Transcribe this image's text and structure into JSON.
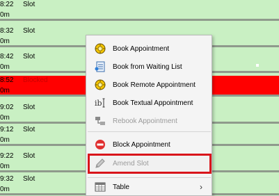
{
  "schedule": {
    "rows": [
      {
        "time": "8:22",
        "duration": "0m",
        "status": "Slot",
        "blocked": false
      },
      {
        "time": "8:32",
        "duration": "0m",
        "status": "Slot",
        "blocked": false
      },
      {
        "time": "8:42",
        "duration": "0m",
        "status": "Slot",
        "blocked": false
      },
      {
        "time": "8:52",
        "duration": "0m",
        "status": "Blocked",
        "blocked": true
      },
      {
        "time": "9:02",
        "duration": "0m",
        "status": "Slot",
        "blocked": false
      },
      {
        "time": "9:12",
        "duration": "0m",
        "status": "Slot",
        "blocked": false
      },
      {
        "time": "9:22",
        "duration": "0m",
        "status": "Slot",
        "blocked": false
      },
      {
        "time": "9:32",
        "duration": "0m",
        "status": "Slot",
        "blocked": false
      }
    ],
    "colors": {
      "slot_bg": "#c9f0c3",
      "blocked_bg": "#ff0000",
      "separator": "#8f9a8c"
    }
  },
  "context_menu": {
    "items": [
      {
        "label": "Book Appointment",
        "icon": "book-appointment-icon",
        "disabled": false
      },
      {
        "label": "Book from Waiting List",
        "icon": "waiting-list-icon",
        "disabled": false
      },
      {
        "label": "Book Remote Appointment",
        "icon": "remote-appointment-icon",
        "disabled": false
      },
      {
        "label": "Book Textual Appointment",
        "icon": "text-cursor-icon",
        "disabled": false
      },
      {
        "label": "Rebook Appointment",
        "icon": "rebook-icon",
        "disabled": true
      },
      {
        "label": "Block Appointment",
        "icon": "block-icon",
        "disabled": false
      },
      {
        "label": "Amend Slot",
        "icon": "pencil-icon",
        "disabled": true,
        "highlighted": true
      },
      {
        "label": "Table",
        "icon": "table-icon",
        "disabled": false,
        "submenu": true
      }
    ],
    "highlight_color": "#d9151b"
  }
}
